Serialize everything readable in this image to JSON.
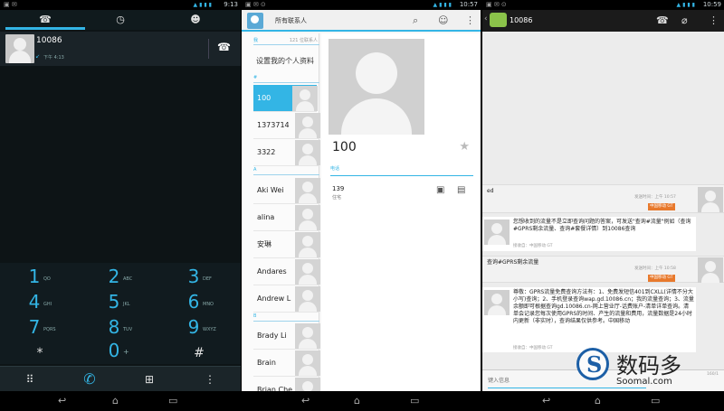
{
  "dialer": {
    "status_time": "9:13",
    "tabs": [
      {
        "icon": "phone-icon"
      },
      {
        "icon": "clock-icon"
      },
      {
        "icon": "contacts-icon"
      }
    ],
    "recent": {
      "number": "10086",
      "time": "下午 4:13"
    },
    "keys": [
      {
        "digit": "1",
        "letters": "QO"
      },
      {
        "digit": "2",
        "letters": "ABC"
      },
      {
        "digit": "3",
        "letters": "DEF"
      },
      {
        "digit": "4",
        "letters": "GHI"
      },
      {
        "digit": "5",
        "letters": "JKL"
      },
      {
        "digit": "6",
        "letters": "MNO"
      },
      {
        "digit": "7",
        "letters": "PQRS"
      },
      {
        "digit": "8",
        "letters": "TUV"
      },
      {
        "digit": "9",
        "letters": "WXYZ"
      },
      {
        "digit": "*",
        "letters": ""
      },
      {
        "digit": "0",
        "letters": "+"
      },
      {
        "digit": "#",
        "letters": ""
      }
    ]
  },
  "contacts": {
    "status_time": "10:57",
    "title": "所有联系人",
    "section_me": "我",
    "section_count": "121 位联系人",
    "self_info": "设置我的个人资料",
    "sections": [
      "#",
      "A",
      "B"
    ],
    "items": [
      "100",
      "1373714",
      "3322",
      "Aki Wei",
      "alina",
      "安琳",
      "Andares",
      "Andrew L",
      "Brady Li",
      "Brain",
      "Brian Che"
    ],
    "detail": {
      "name": "100",
      "phone_header": "电话",
      "phone": "139",
      "phone_type": "住宅"
    }
  },
  "messaging": {
    "status_time": "10:59",
    "title": "10086",
    "messages": [
      {
        "dir": "out",
        "text": "ed",
        "meta": "发送时间：上午 10:57",
        "tag": "中国移动 GT"
      },
      {
        "dir": "in",
        "text": "您想收到的流量不是立即查询问题的答案，可发送\"查询#流量\"例如（查询#GPRS剩余流量、查询#套餐详情）到10086查询",
        "meta": "接收自：中国移动 GT"
      },
      {
        "dir": "out",
        "text": "查询#GPRS剩余流量",
        "meta": "发送时间：上午 10:58",
        "tag": "中国移动 GT"
      },
      {
        "dir": "in",
        "text": "尊敬：GPRS流量免费查询方法有：1、免费发短信401到CXLL(详情不分大小写)查询；2、手机登录查询wap.gd.10086.cn；我的流量查询；3、流量余额即可根据查询gd.10086.cn-网上营业厅-话费账户-清单详单查询。清单会记录您每次使用GPRS的时间、产生的流量和费用，流量数据是24小时内更新（非实时），查询结果仅供参考。中国移动",
        "meta": "接收自：中国移动 GT"
      }
    ],
    "compose_placeholder": "键入信息",
    "char_count": "160/1"
  },
  "watermark": {
    "cn": "数码多",
    "en": "Soomal.com"
  },
  "colors": {
    "accent": "#33b5e5",
    "tag": "#e8792c"
  }
}
